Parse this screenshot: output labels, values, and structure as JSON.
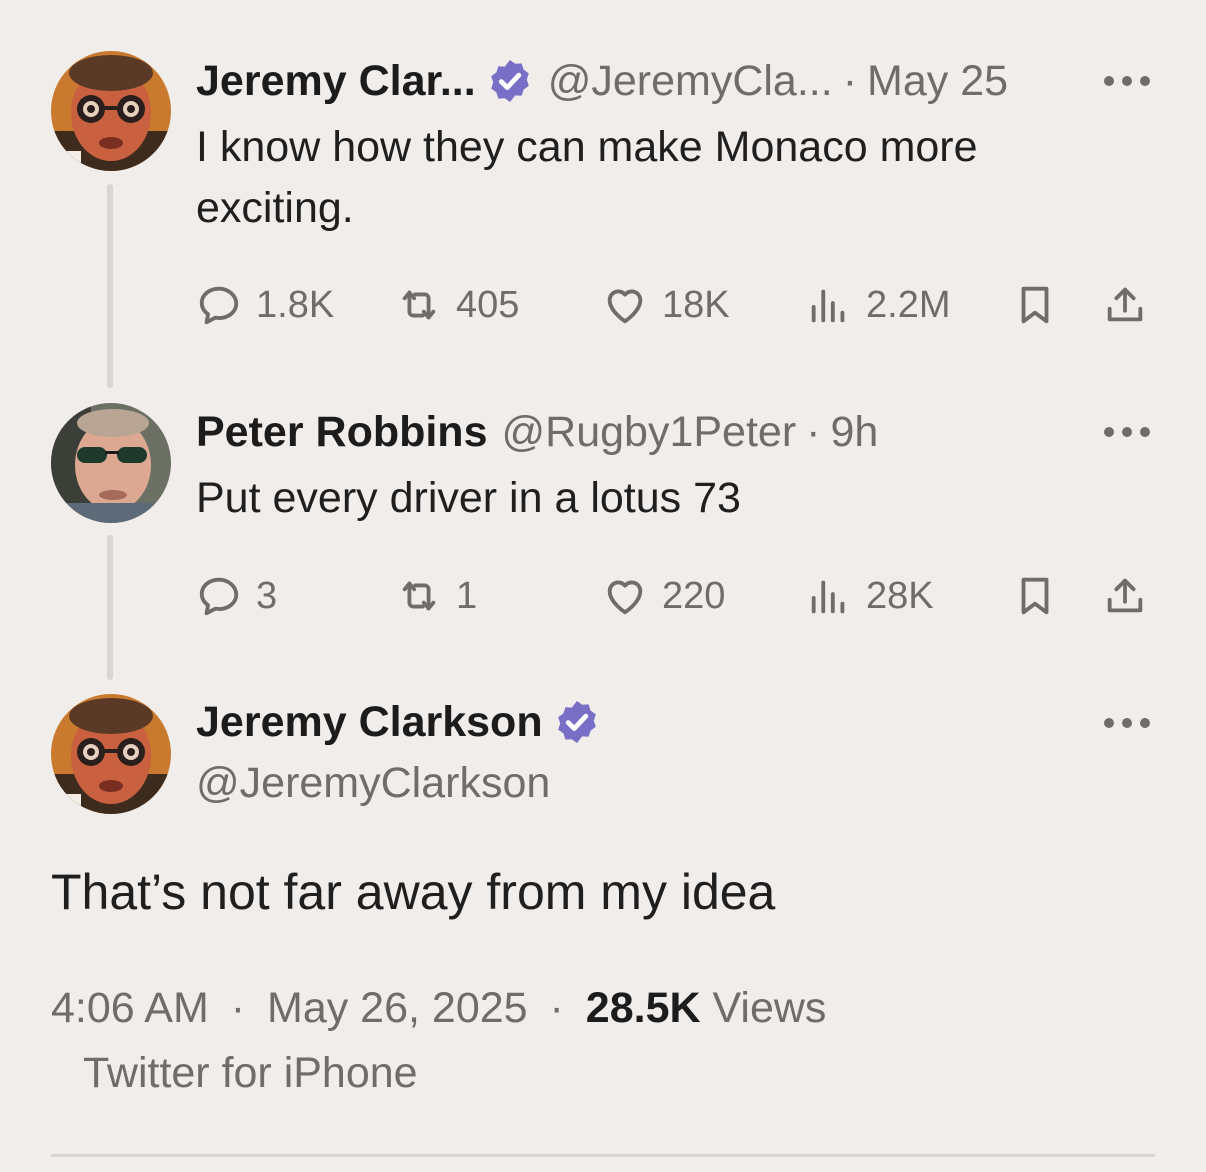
{
  "tweets": [
    {
      "name": "Jeremy Clar...",
      "handle": "@JeremyCla...",
      "separator": "·",
      "time": "May 25",
      "text": "I know how they can make Monaco more exciting.",
      "replies": "1.8K",
      "retweets": "405",
      "likes": "18K",
      "views": "2.2M",
      "avatar_icon": "jeremy-avatar"
    },
    {
      "name": "Peter Robbins",
      "handle": "@Rugby1Peter",
      "separator": "·",
      "time": "9h",
      "text": "Put every driver in a lotus 73",
      "replies": "3",
      "retweets": "1",
      "likes": "220",
      "views": "28K",
      "avatar_icon": "peter-avatar"
    }
  ],
  "main_tweet": {
    "name": "Jeremy Clarkson",
    "handle": "@JeremyClarkson",
    "text": "That’s not far away from my idea",
    "time": "4:06 AM",
    "separator": "·",
    "date": "May 26, 2025",
    "views_count": "28.5K",
    "views_label": "Views",
    "source": "Twitter for iPhone"
  },
  "colors": {
    "background": "#f0edeb",
    "verified": "#7a6fc6",
    "secondary_text": "#6f6c6a",
    "primary_text": "#1f1f1f"
  }
}
